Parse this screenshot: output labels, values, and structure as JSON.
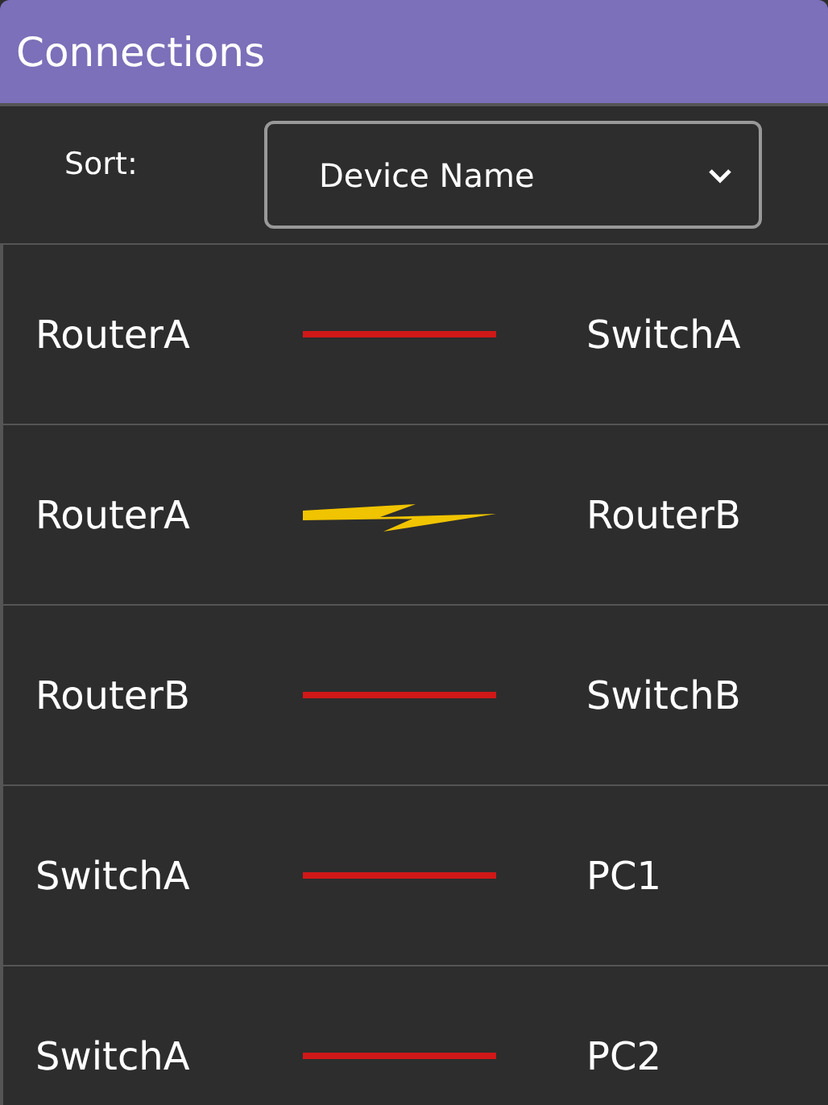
{
  "header": {
    "title": "Connections"
  },
  "sort": {
    "label": "Sort:",
    "value": "Device Name"
  },
  "connections": [
    {
      "from": "RouterA",
      "to": "SwitchA",
      "kind": "ethernet"
    },
    {
      "from": "RouterA",
      "to": "RouterB",
      "kind": "serial"
    },
    {
      "from": "RouterB",
      "to": "SwitchB",
      "kind": "ethernet"
    },
    {
      "from": "SwitchA",
      "to": "PC1",
      "kind": "ethernet"
    },
    {
      "from": "SwitchA",
      "to": "PC2",
      "kind": "ethernet"
    }
  ]
}
